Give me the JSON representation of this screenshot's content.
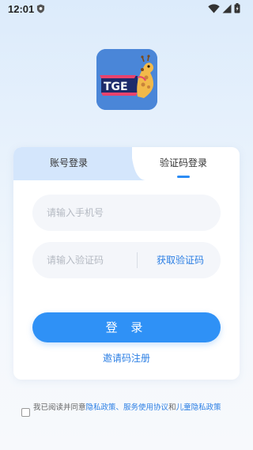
{
  "status_bar": {
    "time": "12:01",
    "icons": [
      "shield-icon",
      "wifi-icon",
      "signal-icon",
      "battery-icon"
    ]
  },
  "app": {
    "logo_text": "TGE"
  },
  "tabs": [
    {
      "label": "账号登录",
      "active": false
    },
    {
      "label": "验证码登录",
      "active": true
    }
  ],
  "form": {
    "phone_placeholder": "请输入手机号",
    "code_placeholder": "请输入验证码",
    "get_code_label": "获取验证码",
    "login_label": "登 录",
    "invite_label": "邀请码注册"
  },
  "agreement": {
    "prefix": "我已阅读并同意",
    "privacy": "隐私政策",
    "separator": "、",
    "service": "服务使用协议",
    "and": "和",
    "child_privacy": "儿童隐私政策"
  },
  "colors": {
    "accent": "#2f91f6",
    "link": "#2c7fe4",
    "tab_inactive_bg": "#d4e6fc"
  }
}
